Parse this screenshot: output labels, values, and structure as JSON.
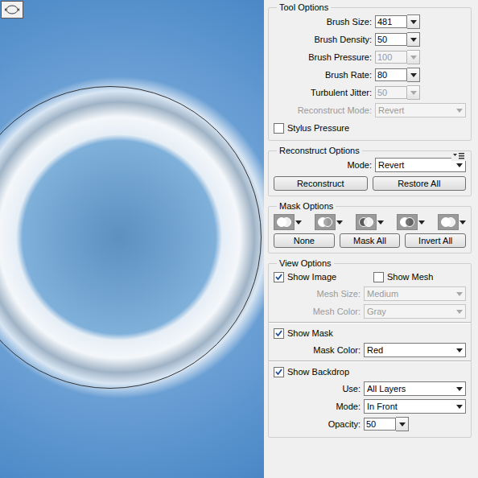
{
  "tool_options": {
    "title": "Tool Options",
    "rows": [
      {
        "label": "Brush Size:",
        "value": "481",
        "kind": "combo",
        "disabled": false
      },
      {
        "label": "Brush Density:",
        "value": "50",
        "kind": "combo",
        "disabled": false
      },
      {
        "label": "Brush Pressure:",
        "value": "100",
        "kind": "combo",
        "disabled": true
      },
      {
        "label": "Brush Rate:",
        "value": "80",
        "kind": "combo",
        "disabled": false
      },
      {
        "label": "Turbulent Jitter:",
        "value": "50",
        "kind": "combo",
        "disabled": true
      },
      {
        "label": "Reconstruct Mode:",
        "value": "Revert",
        "kind": "select",
        "disabled": true
      }
    ],
    "stylus": {
      "label": "Stylus Pressure",
      "checked": false
    }
  },
  "reconstruct_options": {
    "title": "Reconstruct Options",
    "mode": {
      "label": "Mode:",
      "value": "Revert",
      "kind": "select",
      "disabled": false
    },
    "buttons": [
      "Reconstruct",
      "Restore All"
    ]
  },
  "mask_options": {
    "title": "Mask Options",
    "buttons": [
      "None",
      "Mask All",
      "Invert All"
    ]
  },
  "view_options": {
    "title": "View Options",
    "groups": [
      {
        "checks": [
          {
            "label": "Show Image",
            "checked": true
          },
          {
            "label": "Show Mesh",
            "checked": false
          }
        ],
        "fields": [
          {
            "label": "Mesh Size:",
            "value": "Medium",
            "kind": "select",
            "disabled": true
          },
          {
            "label": "Mesh Color:",
            "value": "Gray",
            "kind": "select",
            "disabled": true
          }
        ]
      },
      {
        "checks": [
          {
            "label": "Show Mask",
            "checked": true
          }
        ],
        "fields": [
          {
            "label": "Mask Color:",
            "value": "Red",
            "kind": "select",
            "disabled": false
          }
        ]
      },
      {
        "checks": [
          {
            "label": "Show Backdrop",
            "checked": true
          }
        ],
        "fields": [
          {
            "label": "Use:",
            "value": "All Layers",
            "kind": "select",
            "disabled": false
          },
          {
            "label": "Mode:",
            "value": "In Front",
            "kind": "select",
            "disabled": false
          },
          {
            "label": "Opacity:",
            "value": "50",
            "kind": "combo",
            "disabled": false
          }
        ]
      }
    ]
  }
}
